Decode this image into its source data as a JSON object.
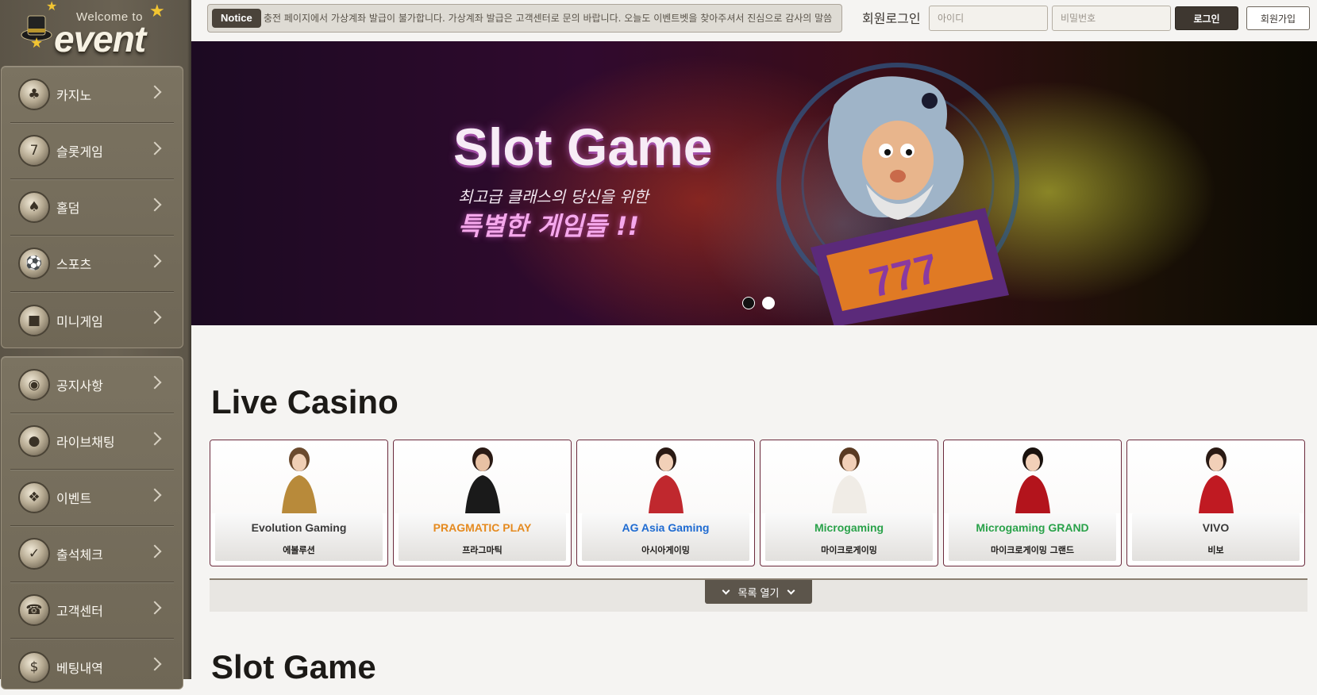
{
  "logo": {
    "welcome": "Welcome to",
    "word": "event"
  },
  "sidebar": {
    "group1": [
      {
        "label": "카지노",
        "icon": "roulette-icon",
        "glyph": "♣"
      },
      {
        "label": "슬롯게임",
        "icon": "slot-machine-icon",
        "glyph": "7"
      },
      {
        "label": "홀덤",
        "icon": "cards-icon",
        "glyph": "♠"
      },
      {
        "label": "스포츠",
        "icon": "sports-icon",
        "glyph": "⚽"
      },
      {
        "label": "미니게임",
        "icon": "mini-game-icon",
        "glyph": "■"
      }
    ],
    "group2": [
      {
        "label": "공지사항",
        "icon": "notice-icon",
        "glyph": "◉"
      },
      {
        "label": "라이브채팅",
        "icon": "chat-icon",
        "glyph": "●"
      },
      {
        "label": "이벤트",
        "icon": "gift-icon",
        "glyph": "❖"
      },
      {
        "label": "출석체크",
        "icon": "checkin-icon",
        "glyph": "✓"
      },
      {
        "label": "고객센터",
        "icon": "telephone-icon",
        "glyph": "☎"
      },
      {
        "label": "베팅내역",
        "icon": "betting-history-icon",
        "glyph": "$"
      }
    ]
  },
  "topbar": {
    "notice_tag": "Notice",
    "notice_text": "충전 페이지에서 가상계좌 발급이 불가합니다. 가상계좌 발급은 고객센터로 문의 바랍니다. 오늘도 이벤트벳을 찾아주셔서 진심으로 감사의 말씀",
    "login_title": "회원로그인",
    "id_placeholder": "아이디",
    "pw_placeholder": "비밀번호",
    "login_button": "로그인",
    "join_button": "회원가입"
  },
  "banner": {
    "title": "Slot Game",
    "subtitle": "최고급 클래스의 당신을 위한",
    "tagline": "특별한 게임들 !!",
    "slides": 2,
    "active_slide": 1
  },
  "live_casino": {
    "title": "Live Casino",
    "cards": [
      {
        "logo": "Evolution Gaming",
        "name": "에볼루션",
        "accent": "#5a5a5a"
      },
      {
        "logo": "PRAGMATIC PLAY",
        "name": "프라그마틱",
        "accent": "#e58a1f"
      },
      {
        "logo": "AG Asia Gaming",
        "name": "아시아게이밍",
        "accent": "#1f6bd1"
      },
      {
        "logo": "Microgaming",
        "name": "마이크로게이밍",
        "accent": "#2aa24a"
      },
      {
        "logo": "Microgaming GRAND",
        "name": "마이크로게이밍 그랜드",
        "accent": "#2aa24a"
      },
      {
        "logo": "VIVO",
        "name": "비보",
        "accent": "#333333"
      }
    ],
    "expand_label": "목록 열기"
  },
  "slot_game": {
    "title": "Slot Game"
  },
  "colors": {
    "sidebar_bg": "#6a6253",
    "accent_dark": "#3e3730",
    "card_border": "#6b2a3c"
  }
}
